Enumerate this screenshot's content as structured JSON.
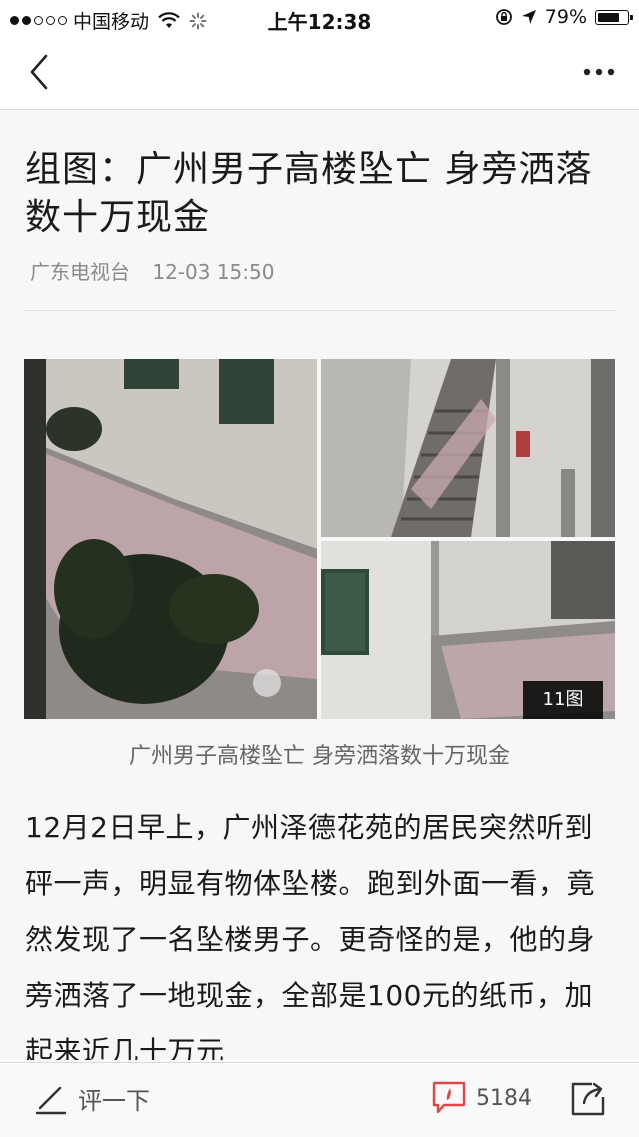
{
  "status_bar": {
    "carrier": "中国移动",
    "time": "上午12:38",
    "battery": "79%",
    "battery_level": 0.79,
    "signal_bars": 2,
    "icons": [
      "wifi-icon",
      "loading-icon",
      "rotation-lock-icon",
      "location-icon",
      "battery-icon"
    ]
  },
  "nav": {
    "back_icon": "chevron-left-icon",
    "more_icon": "more-dots-icon"
  },
  "article": {
    "title": "组图：广州男子高楼坠亡 身旁洒落数十万现金",
    "source": "广东电视台",
    "datetime": "12-03 15:50",
    "photo_count": "11图",
    "caption": "广州男子高楼坠亡 身旁洒落数十万现金",
    "body": "12月2日早上，广州泽德花苑的居民突然听到砰一声，明显有物体坠楼。跑到外面一看，竟然发现了一名坠楼男子。更奇怪的是，他的身旁洒落了一地现金，全部是100元的纸币，加起来近几十万元"
  },
  "bottom_bar": {
    "comment_label": "评一下",
    "comment_count": "5184",
    "icons": [
      "pencil-icon",
      "comment-bubble-icon",
      "share-icon"
    ]
  },
  "colors": {
    "accent_red": "#e04848",
    "background": "#f7f7f7"
  }
}
